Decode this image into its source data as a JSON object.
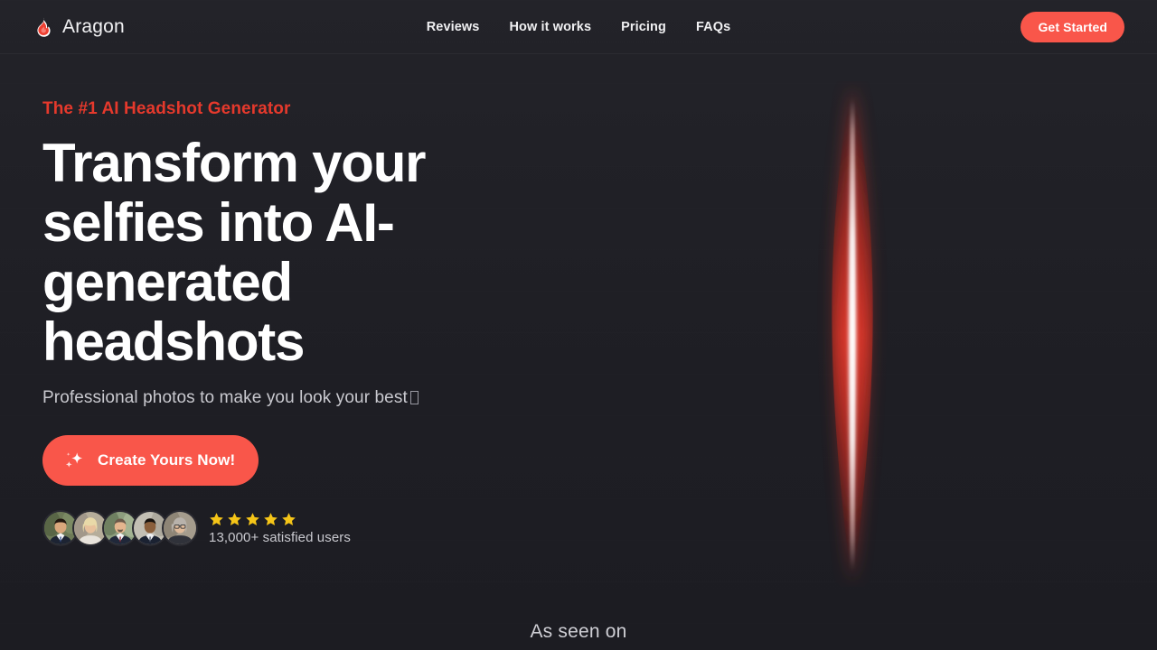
{
  "colors": {
    "background": "#212127",
    "accent": "#f9564a",
    "eyebrow": "#e5392c",
    "star": "#f5c518",
    "text_primary": "#ffffff",
    "text_muted": "#c9c9cf"
  },
  "navbar": {
    "brand_name": "Aragon",
    "brand_icon": "flame-icon",
    "links": [
      {
        "label": "Reviews"
      },
      {
        "label": "How it works"
      },
      {
        "label": "Pricing"
      },
      {
        "label": "FAQs"
      }
    ],
    "cta_label": "Get Started"
  },
  "hero": {
    "eyebrow": "The #1 AI Headshot Generator",
    "headline": "Transform your selfies into AI-generated headshots",
    "subhead": "Professional photos to make you look your best",
    "subhead_trailing_glyph": "missing-glyph-box",
    "cta_label": "Create Yours Now!",
    "cta_icon": "sparkle-icon"
  },
  "social_proof": {
    "avatar_count": 5,
    "avatars": [
      {
        "alt": "user-avatar-1"
      },
      {
        "alt": "user-avatar-2"
      },
      {
        "alt": "user-avatar-3"
      },
      {
        "alt": "user-avatar-4"
      },
      {
        "alt": "user-avatar-5"
      }
    ],
    "star_count": 5,
    "rating_label": "13,000+ satisfied users"
  },
  "decoration": {
    "beam": "vertical-red-light-beam"
  },
  "footer_section": {
    "label": "As seen on"
  }
}
